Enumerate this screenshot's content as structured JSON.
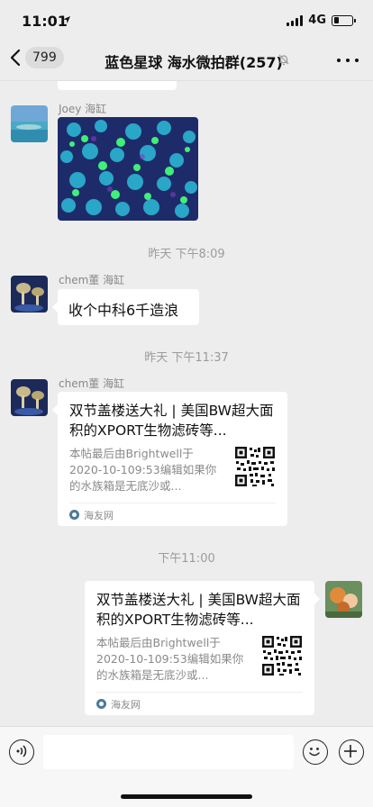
{
  "status_bar": {
    "time": "11:01",
    "network": "4G"
  },
  "nav": {
    "unread_count": "799",
    "title": "蓝色星球 海水微拍群(257)",
    "muted": true
  },
  "messages": {
    "m1": {
      "sender": "Joey 海缸",
      "type": "image"
    },
    "ts1": "昨天 下午8:09",
    "m2": {
      "sender": "chem董 海缸",
      "text": "收个中科6千造浪"
    },
    "ts2": "昨天 下午11:37",
    "m3": {
      "sender": "chem董 海缸",
      "type": "link",
      "title": "双节盖楼送大礼 | 美国BW超大面积的XPORT生物滤砖等...",
      "desc": "本帖最后由Brightwell于2020-10-109:53编辑如果你的水族箱是无底沙或...",
      "source": "海友网"
    },
    "ts3": "下午11:00",
    "m4": {
      "sender": "me",
      "type": "link",
      "title": "双节盖楼送大礼 | 美国BW超大面积的XPORT生物滤砖等...",
      "desc": "本帖最后由Brightwell于2020-10-109:53编辑如果你的水族箱是无底沙或...",
      "source": "海友网"
    }
  },
  "input": {
    "placeholder": ""
  },
  "icons": {
    "back": "chevron-left-icon",
    "mute": "bell-slash-icon",
    "more": "more-dots-icon",
    "voice": "voice-icon",
    "emoji": "emoji-icon",
    "plus": "plus-icon",
    "source": "source-logo-icon"
  },
  "colors": {
    "background": "#ededed",
    "bubble": "#ffffff",
    "timestamp": "#9b9b9b"
  }
}
